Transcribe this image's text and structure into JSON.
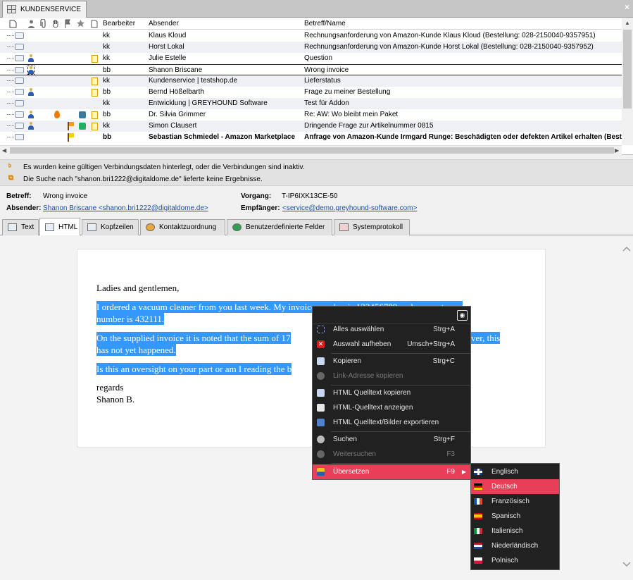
{
  "window": {
    "tab_label": "KUNDENSERVICE",
    "close_glyph": "×"
  },
  "grid": {
    "headers": {
      "bearbeiter": "Bearbeiter",
      "absender": "Absender",
      "betreff": "Betreff/Name"
    },
    "header_icons": [
      "page-icon",
      "person-icon",
      "attachment-icon",
      "hand-icon",
      "flag-icon",
      "star-icon",
      "note-icon"
    ],
    "rows": [
      {
        "bearbeiter": "kk",
        "absender": "Klaus Kloud",
        "betreff": "Rechnungsanforderung von Amazon-Kunde Klaus Kloud (Bestellung: 028-2150040-9357951)"
      },
      {
        "bearbeiter": "kk",
        "absender": "Horst Lokal",
        "betreff": "Rechnungsanforderung von Amazon-Kunde Horst Lokal (Bestellung: 028-2150040-9357952)"
      },
      {
        "bearbeiter": "kk",
        "absender": "Julie Estelle",
        "betreff": "Question"
      },
      {
        "bearbeiter": "bb",
        "absender": "Shanon Briscane",
        "betreff": "Wrong invoice"
      },
      {
        "bearbeiter": "kk",
        "absender": "Kundenservice | testshop.de",
        "betreff": "Lieferstatus"
      },
      {
        "bearbeiter": "bb",
        "absender": "Bernd Hößelbarth",
        "betreff": "Frage zu meiner Bestellung"
      },
      {
        "bearbeiter": "kk",
        "absender": "Entwicklung | GREYHOUND Software",
        "betreff": "Test für Addon"
      },
      {
        "bearbeiter": "bb",
        "absender": "Dr. Silvia Grimmer",
        "betreff": "Re: AW: Wo bleibt mein Paket"
      },
      {
        "bearbeiter": "kk",
        "absender": "Simon Clausert",
        "betreff": "Dringende Frage zur Artikelnummer 0815"
      },
      {
        "bearbeiter": "bb",
        "absender": "Sebastian Schmiedel - Amazon Marketplace",
        "betreff": "Anfrage von Amazon-Kunde Irmgard Runge: Beschädigten oder defekten Artikel erhalten (Bestell"
      }
    ]
  },
  "info": {
    "line1": "Es wurden keine gültigen Verbindungsdaten hinterlegt, oder die Verbindungen sind inaktiv.",
    "line2": "Die Suche nach \"shanon.bri1222@digitaldome.de\" lieferte keine Ergebnisse."
  },
  "meta": {
    "betreff_label": "Betreff:",
    "betreff_value": "Wrong invoice",
    "vorgang_label": "Vorgang:",
    "vorgang_value": "T-IP6IXK13CE-50",
    "absender_label": "Absender:",
    "absender_value": "Shanon Briscane <shanon.bri1222@digitaldome.de>",
    "empfaenger_label": "Empfänger:",
    "empfaenger_value": "<service@demo.greyhound-software.com>"
  },
  "tabs": [
    "Text",
    "HTML",
    "Kopfzeilen",
    "Kontaktzuordnung",
    "Benutzerdefinierte Felder",
    "Systemprotokoll"
  ],
  "email": {
    "greeting": "Ladies and gentlemen,",
    "p1a": "I ordered a vacuum cleaner from you last week. My invoice number is 123456789 and my customer",
    "p1b": "number is 432111.",
    "p2a": "On the supplied invoice it is noted that the sum of 17",
    "p2a_end": "ver, this",
    "p2b": "has not yet happened.",
    "p3": "Is this an oversight on your part or am I reading the b",
    "regards": "regards",
    "name": "Shanon B."
  },
  "context_menu": {
    "items": [
      {
        "label": "Alles auswählen",
        "shortcut": "Strg+A",
        "icon": "select-all-icon",
        "disabled": false
      },
      {
        "label": "Auswahl aufheben",
        "shortcut": "Umsch+Strg+A",
        "icon": "deselect-icon",
        "disabled": false
      },
      {
        "label": "Kopieren",
        "shortcut": "Strg+C",
        "icon": "copy-icon",
        "disabled": false
      },
      {
        "label": "Link-Adresse kopieren",
        "shortcut": "",
        "icon": "link-icon",
        "disabled": true
      },
      {
        "label": "HTML Quelltext kopieren",
        "shortcut": "",
        "icon": "copy-source-icon",
        "disabled": false
      },
      {
        "label": "HTML-Quelltext anzeigen",
        "shortcut": "",
        "icon": "view-source-icon",
        "disabled": false
      },
      {
        "label": "HTML Quelltext/Bilder exportieren",
        "shortcut": "",
        "icon": "save-icon",
        "disabled": false
      },
      {
        "label": "Suchen",
        "shortcut": "Strg+F",
        "icon": "search-icon",
        "disabled": false
      },
      {
        "label": "Weitersuchen",
        "shortcut": "F3",
        "icon": "search-next-icon",
        "disabled": true
      },
      {
        "label": "Übersetzen",
        "shortcut": "F9",
        "icon": "translate-icon",
        "disabled": false
      }
    ]
  },
  "submenu": {
    "items": [
      {
        "label": "Englisch",
        "flag": "uk-flag-icon"
      },
      {
        "label": "Deutsch",
        "flag": "german-flag-icon"
      },
      {
        "label": "Französisch",
        "flag": "french-flag-icon"
      },
      {
        "label": "Spanisch",
        "flag": "spanish-flag-icon"
      },
      {
        "label": "Italienisch",
        "flag": "italian-flag-icon"
      },
      {
        "label": "Niederländisch",
        "flag": "dutch-flag-icon"
      },
      {
        "label": "Polnisch",
        "flag": "polish-flag-icon"
      }
    ]
  },
  "colors": {
    "highlight": "#3399ff",
    "menu_bg": "#212121",
    "menu_hot": "#e83e57"
  }
}
